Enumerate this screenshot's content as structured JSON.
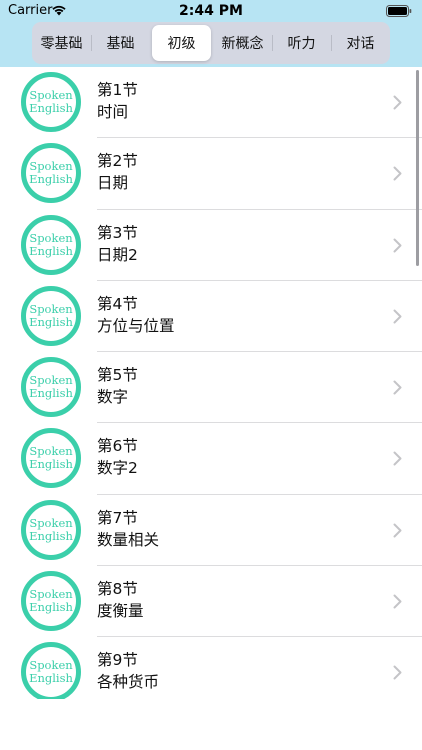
{
  "status": {
    "carrier": "Carrier",
    "time": "2:44 PM"
  },
  "tabs": {
    "items": [
      {
        "label": "零基础",
        "active": false
      },
      {
        "label": "基础",
        "active": false
      },
      {
        "label": "初级",
        "active": true
      },
      {
        "label": "新概念",
        "active": false
      },
      {
        "label": "听力",
        "active": false
      },
      {
        "label": "对话",
        "active": false
      }
    ]
  },
  "thumbnail": {
    "line1": "Spoken",
    "line2": "English"
  },
  "lessons": [
    {
      "title": "第1节",
      "subtitle": "时间"
    },
    {
      "title": "第2节",
      "subtitle": "日期"
    },
    {
      "title": "第3节",
      "subtitle": "日期2"
    },
    {
      "title": "第4节",
      "subtitle": "方位与位置"
    },
    {
      "title": "第5节",
      "subtitle": "数字"
    },
    {
      "title": "第6节",
      "subtitle": "数字2"
    },
    {
      "title": "第7节",
      "subtitle": "数量相关"
    },
    {
      "title": "第8节",
      "subtitle": "度衡量"
    },
    {
      "title": "第9节",
      "subtitle": "各种货币"
    }
  ],
  "colors": {
    "header_bg": "#b7e4f3",
    "accent": "#3bcfaa"
  },
  "icons": {
    "wifi": "wifi-icon",
    "battery": "battery-icon",
    "chevron": "chevron-right-icon"
  }
}
